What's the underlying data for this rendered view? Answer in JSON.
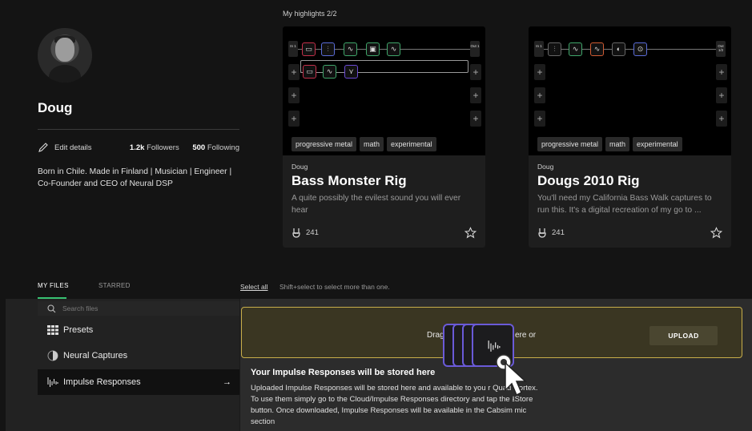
{
  "profile": {
    "name": "Doug",
    "edit_label": "Edit details",
    "followers_count": "1.2k",
    "followers_label": "Followers",
    "following_count": "500",
    "following_label": "Following",
    "bio": "Born in Chile. Made in Finland | Musician | Engineer | Co-Founder and CEO of Neural DSP"
  },
  "highlights": {
    "title": "My highlights 2/2",
    "cards": [
      {
        "author": "Doug",
        "title": "Bass Monster Rig",
        "description": "A quite possibly the evilest sound you will ever hear",
        "tags": [
          "progressive metal",
          "math",
          "experimental"
        ],
        "likes": "241",
        "in_label": "In 1",
        "out_label": "Out 1"
      },
      {
        "author": "Doug",
        "title": "Dougs 2010 Rig",
        "description": "You'll need my California Bass Walk captures to run this. It's a digital recreation of my go to ...",
        "tags": [
          "progressive metal",
          "math",
          "experimental"
        ],
        "likes": "241",
        "in_label": "In 1",
        "out_label": "Out 1/2"
      }
    ]
  },
  "files": {
    "tabs": [
      "MY FILES",
      "STARRED"
    ],
    "select_all": "Select all",
    "select_hint": "Shift+select to select more than one.",
    "search_placeholder": "Search files",
    "nav": [
      {
        "label": "Presets",
        "icon": "grid-icon"
      },
      {
        "label": "Neural Captures",
        "icon": "capture-icon"
      },
      {
        "label": "Impulse Responses",
        "icon": "impulse-response-icon",
        "selected": true
      }
    ],
    "drop_text_left": "Drag",
    "drop_text_right": "ere or",
    "upload_label": "UPLOAD",
    "info_title": "Your Impulse Responses will be stored here",
    "info_body": "Uploaded Impulse Responses will be stored here and available to you r Quad Cortex. To use them simply go to the Cloud/Impulse Responses directory and tap the ⭳Store button. Once downloaded, Impulse Responses will be available in the Cabsim mic section"
  },
  "colors": {
    "accent_green": "#38c172",
    "drop_border": "#c8ae4a",
    "drag_border": "#6a5ad8"
  }
}
